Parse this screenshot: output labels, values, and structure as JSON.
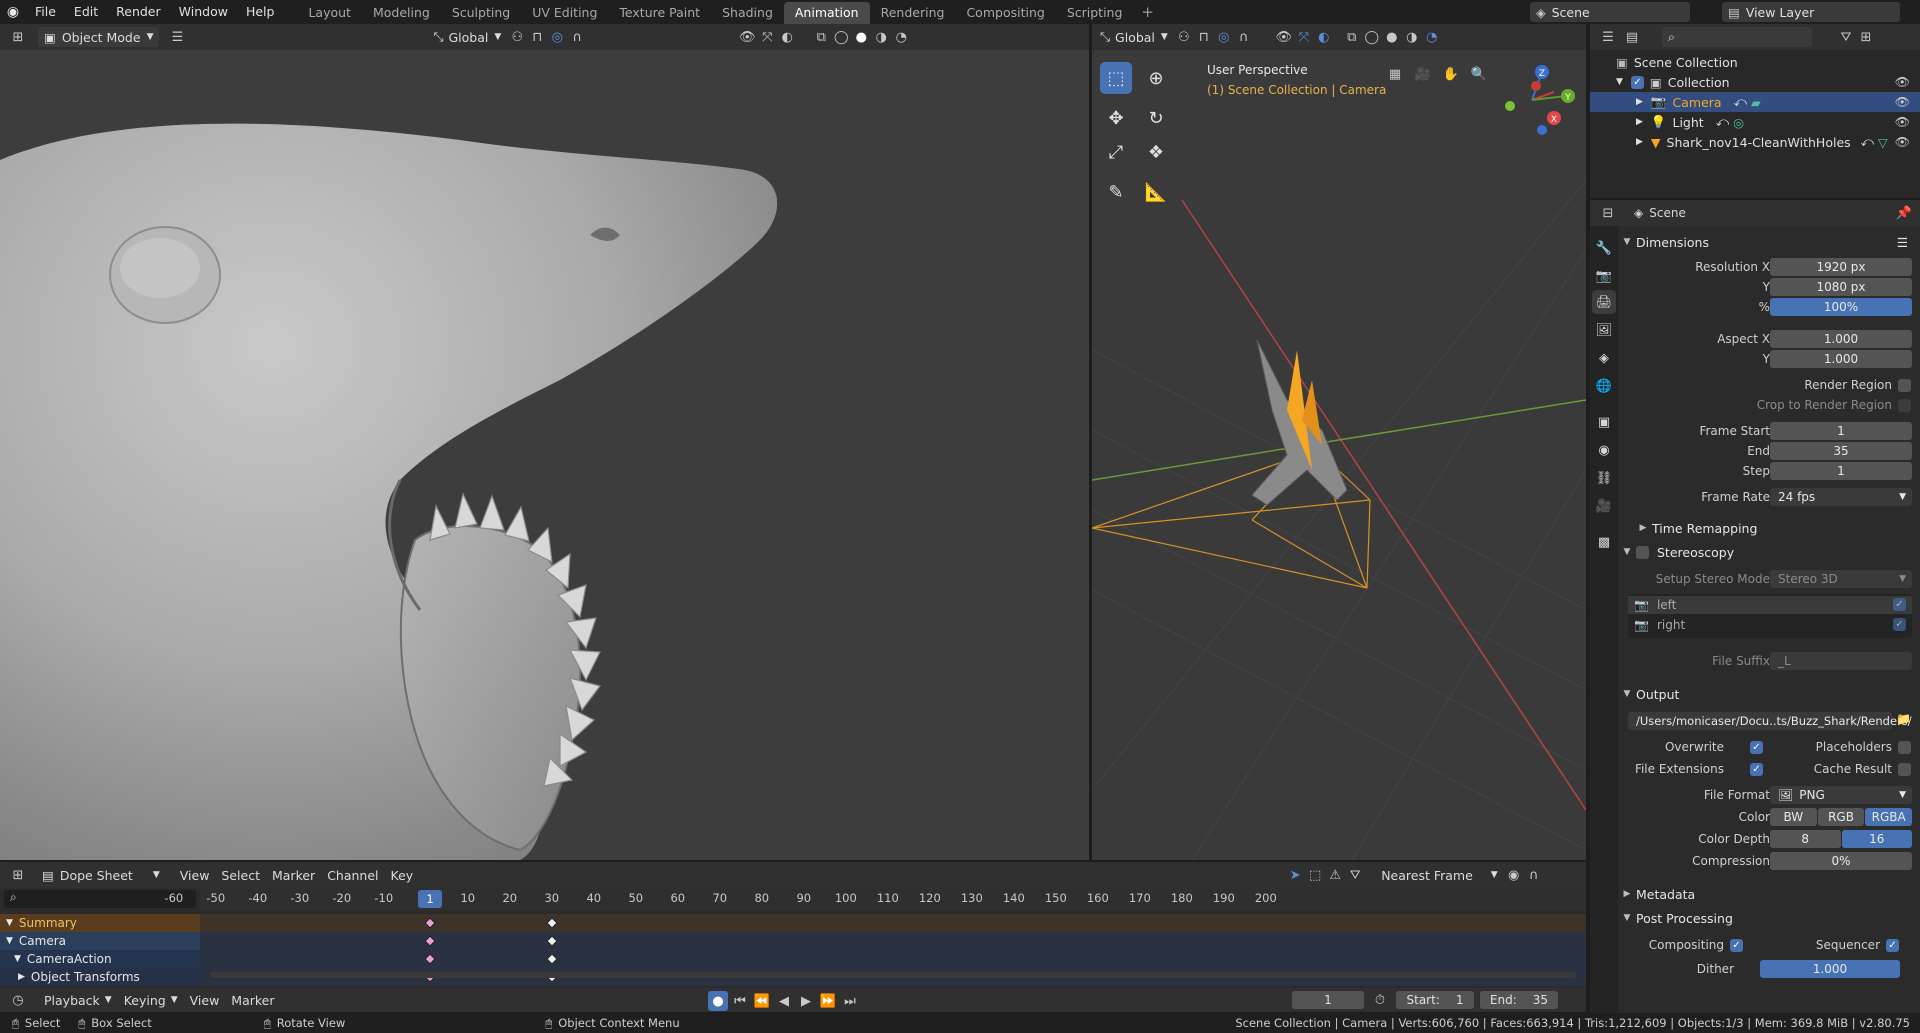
{
  "app": {
    "menus": [
      "File",
      "Edit",
      "Render",
      "Window",
      "Help"
    ],
    "workspaces": [
      "Layout",
      "Modeling",
      "Sculpting",
      "UV Editing",
      "Texture Paint",
      "Shading",
      "Animation",
      "Rendering",
      "Compositing",
      "Scripting"
    ],
    "active_workspace": "Animation",
    "scene_name": "Scene",
    "view_layer": "View Layer"
  },
  "viewport_left": {
    "mode": "Object Mode",
    "orientation": "Global"
  },
  "viewport_right": {
    "orientation": "Global",
    "perspective": "User Perspective",
    "context": "(1) Scene Collection | Camera"
  },
  "outliner": {
    "root": "Scene Collection",
    "collection": "Collection",
    "objects": [
      {
        "name": "Camera",
        "selected": true
      },
      {
        "name": "Light",
        "selected": false
      },
      {
        "name": "Shark_nov14-CleanWithHoles",
        "selected": false
      }
    ]
  },
  "properties": {
    "context_title": "Scene",
    "dimensions": {
      "title": "Dimensions",
      "resolution_x_label": "Resolution X",
      "resolution_x": "1920 px",
      "y_label": "Y",
      "resolution_y": "1080 px",
      "pct_label": "%",
      "percent": "100%",
      "aspect_x_label": "Aspect X",
      "aspect_x": "1.000",
      "aspect_y": "1.000",
      "render_region": "Render Region",
      "crop": "Crop to Render Region",
      "frame_start_label": "Frame Start",
      "frame_start": "1",
      "end_label": "End",
      "frame_end": "35",
      "step_label": "Step",
      "step": "1",
      "frame_rate_label": "Frame Rate",
      "frame_rate": "24 fps"
    },
    "time_remapping": "Time Remapping",
    "stereoscopy": {
      "title": "Stereoscopy",
      "mode_label": "Setup Stereo Mode",
      "mode": "Stereo 3D",
      "left": "left",
      "right": "right",
      "suffix_label": "File Suffix",
      "suffix": "_L"
    },
    "output": {
      "title": "Output",
      "path": "/Users/monicaser/Docu..ts/Buzz_Shark/Renders/",
      "overwrite": "Overwrite",
      "placeholders": "Placeholders",
      "file_extensions": "File Extensions",
      "cache_result": "Cache Result",
      "file_format_label": "File Format",
      "file_format": "PNG",
      "color_label": "Color",
      "color_options": [
        "BW",
        "RGB",
        "RGBA"
      ],
      "color_depth_label": "Color Depth",
      "depth_options": [
        "8",
        "16"
      ],
      "compression_label": "Compression",
      "compression": "0%"
    },
    "metadata": "Metadata",
    "post_processing": {
      "title": "Post Processing",
      "compositing": "Compositing",
      "sequencer": "Sequencer",
      "dither_label": "Dither",
      "dither": "1.000"
    }
  },
  "dopesheet": {
    "editor": "Dope Sheet",
    "menus": [
      "View",
      "Select",
      "Marker",
      "Channel",
      "Key"
    ],
    "snap": "Nearest Frame",
    "ticks": [
      "-60",
      "-50",
      "-40",
      "-30",
      "-20",
      "-10",
      "10",
      "20",
      "30",
      "40",
      "50",
      "60",
      "70",
      "80",
      "90",
      "100",
      "110",
      "120",
      "130",
      "140",
      "150",
      "160",
      "170",
      "180",
      "190",
      "200"
    ],
    "current_frame": "1",
    "channels": [
      "Summary",
      "Camera",
      "CameraAction",
      "Object Transforms"
    ],
    "keyframes": [
      1,
      30
    ]
  },
  "timeline": {
    "menus": [
      "Playback",
      "Keying",
      "View",
      "Marker"
    ],
    "frame": "1",
    "start_label": "Start:",
    "start": "1",
    "end_label": "End:",
    "end": "35"
  },
  "status": {
    "select": "Select",
    "box_select": "Box Select",
    "rotate": "Rotate View",
    "context_menu": "Object Context Menu",
    "stats": "Scene Collection | Camera | Verts:606,760 | Faces:663,914 | Tris:1,212,609 | Objects:1/3 | Mem: 369.8 MiB | v2.80.75"
  },
  "colors": {
    "accent": "#4772b3",
    "selection": "#334d80",
    "camera_orange": "#f5a623",
    "context_yellow": "#e6b44a"
  }
}
